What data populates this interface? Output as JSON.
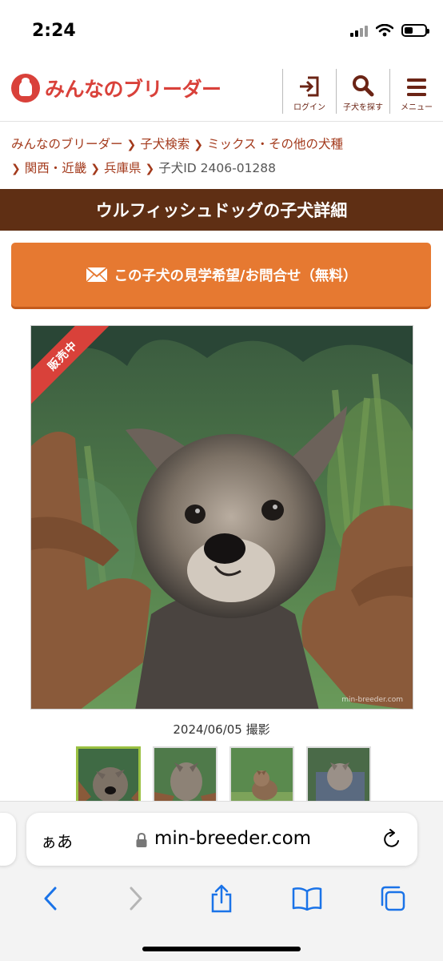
{
  "status_bar": {
    "time": "2:24",
    "battery_level": 0.4
  },
  "header": {
    "logo_text": "みんなのブリーダー",
    "brand_color": "#d9413a",
    "nav": [
      {
        "label": "ログイン",
        "icon": "login-icon"
      },
      {
        "label": "子犬を探す",
        "icon": "search-icon"
      },
      {
        "label": "メニュー",
        "icon": "menu-icon"
      }
    ]
  },
  "breadcrumb": {
    "items": [
      "みんなのブリーダー",
      "子犬検索",
      "ミックス・その他の犬種",
      "関西・近畿",
      "兵庫県"
    ],
    "current": "子犬ID 2406-01288"
  },
  "title": "ウルフィッシュドッグの子犬詳細",
  "inquiry_button": {
    "label": "この子犬の見学希望/お問合せ（無料）",
    "icon": "mail-icon",
    "color": "#e67931"
  },
  "photo": {
    "ribbon": "販売中",
    "watermark": "min-breeder.com",
    "date": "2024/06/05 撮影",
    "thumbnail_count": 4,
    "selected_thumbnail": 0
  },
  "safari": {
    "aa_label": "ぁあ",
    "url": "min-breeder.com"
  }
}
